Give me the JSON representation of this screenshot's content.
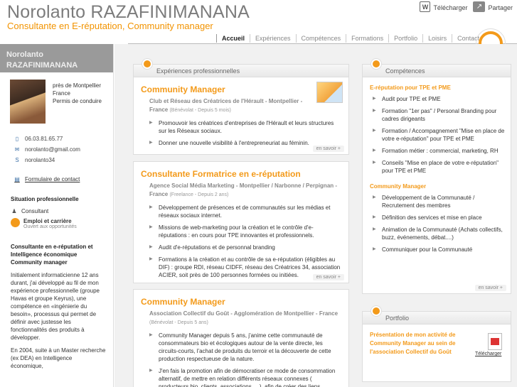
{
  "header": {
    "name": "Norolanto RAZAFINIMANANA",
    "tagline": "Consultante en E-réputation, Community manager",
    "download": "Télécharger",
    "share": "Partager"
  },
  "nav": [
    "Accueil",
    "Expériences",
    "Compétences",
    "Formations",
    "Portfolio",
    "Loisirs",
    "Contact"
  ],
  "sidebar": {
    "name_line1": "Norolanto",
    "name_line2": "RAZAFINIMANANA",
    "location": "près de Montpellier",
    "country": "France",
    "license": "Permis de conduire",
    "phone": "06.03.81.65.77",
    "email": "norolanto@gmail.com",
    "skype": "norolanto34",
    "contact_form": "Formulaire de contact",
    "situation_title": "Situation professionnelle",
    "situation_value": "Consultant",
    "emploi_title": "Emploi et carrière",
    "emploi_sub": "Ouvert aux opportunités",
    "summary_title": "Consultante en e-réputation et Intelligence économique Community manager",
    "summary_p1": "Initialement informaticienne 12 ans durant, j'ai développé au fil de mon expérience professionnelle (groupe Havas et groupe Keyrus), une compétence en «ingénierie du besoin», processus qui permet de définir avec justesse les fonctionnalités des produits à développer.",
    "summary_p2": "En 2004, suite à un Master recherche (ex DEA) en Intelligence économique,"
  },
  "experiences": {
    "header": "Expériences professionnelles",
    "more": "en savoir +",
    "jobs": [
      {
        "title": "Community Manager",
        "org": "Club et Réseau des Créatrices de l'Hérault - Montpellier - France",
        "meta": "(Bénévolat - Depuis 5 mois)",
        "bullets": [
          "Promouvoir les créatrices d'entreprises de l'Hérault et leurs structures sur les Réseaux sociaux.",
          "Donner une nouvelle visibilité à l'entrepreneuriat au féminin."
        ]
      },
      {
        "title": "Consultante Formatrice en e-réputation",
        "org": "Agence Social Média Marketing - Montpellier / Narbonne / Perpignan - France",
        "meta": "(Freelance - Depuis 2 ans)",
        "bullets": [
          "Développement de présences et de communautés sur les médias et réseaux sociaux internet.",
          "Missions de web-marketing pour la création et le contrôle d'e-réputations : en cours pour TPE innovantes et professionnels.",
          "Audit d'e-réputations et de personnal branding",
          "Formations à la création et au contrôle de sa e-réputation (éligibles au DIF) : groupe RDI, réseau CIDFF, réseau des Créatrices 34, association ACIER, soit près de 100 personnes formées ou initiées."
        ]
      },
      {
        "title": "Community Manager",
        "org": "Association Collectif du Goût - Agglomération de Montpellier - France",
        "meta": "(Bénévolat - Depuis 5 ans)",
        "bullets": [
          "Community Manager depuis 5 ans, j'anime cette communauté de consommateurs bio et écologiques autour de la vente directe, les circuits-courts, l'achat de produits du terroir et la découverte de cette production respectueuse de la nature.",
          "J'en fais la promotion afin de démocratiser ce mode de consommation alternatif, de mettre en relation différents réseaux connexes ( producteurs bio, clients, associations, ...), afin de créer des liens"
        ]
      }
    ]
  },
  "competences": {
    "header": "Compétences",
    "more": "en savoir +",
    "groups": [
      {
        "title": "E-réputation pour TPE et PME",
        "items": [
          "Audit pour TPE et PME",
          "Formation \"1er pas\" / Personal Branding pour cadres dirigeants",
          "Formation / Accompagnement \"Mise en place de votre e-réputation\" pour TPE et PME",
          "Formation métier : commercial, marketing, RH",
          "Conseils \"Mise en place de votre e-réputation\" pour TPE et PME"
        ]
      },
      {
        "title": "Community Manager",
        "items": [
          "Développement de la Communauté / Recrutement des membres",
          "Définition des services et mise en place",
          "Animation de la Communauté (Achats collectifs, buzz, événements, débat....)",
          "Communiquer pour la Communauté"
        ]
      }
    ]
  },
  "portfolio": {
    "header": "Portfolio",
    "item": "Présentation de mon activité de Community Manager au sein de l'association Collectif du Goût",
    "download": "Télécharger"
  }
}
